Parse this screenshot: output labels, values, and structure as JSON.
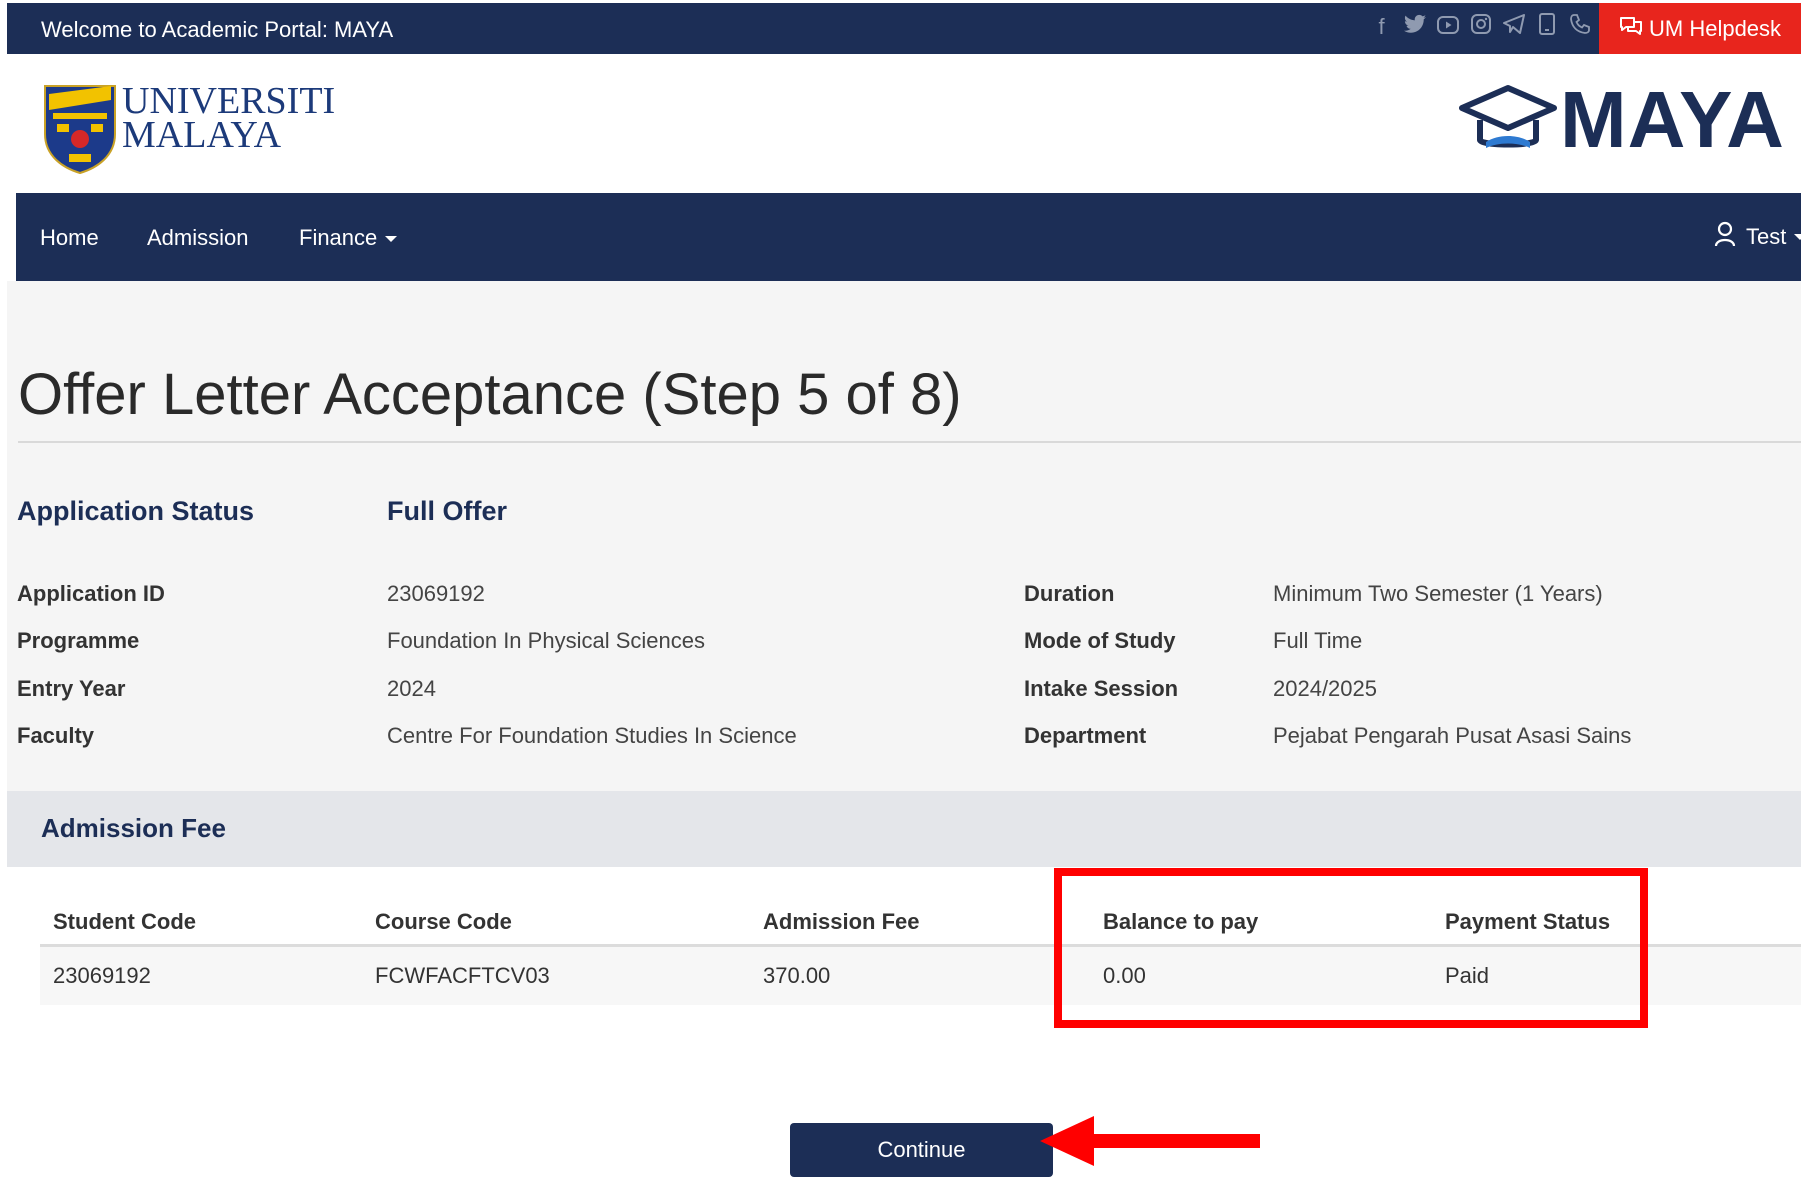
{
  "topbar": {
    "welcome": "Welcome to Academic Portal: MAYA",
    "social_icons": [
      "facebook-icon",
      "twitter-icon",
      "youtube-icon",
      "instagram-icon",
      "telegram-icon",
      "mobile-icon",
      "phone-icon"
    ],
    "helpdesk_label": "UM Helpdesk"
  },
  "header": {
    "university_line1": "UNIVERSITI",
    "university_line2": "MALAYA",
    "portal_logo_text": "MAYA"
  },
  "nav": {
    "items": [
      {
        "label": "Home"
      },
      {
        "label": "Admission"
      },
      {
        "label": "Finance"
      }
    ],
    "user_label": "Test"
  },
  "page": {
    "title": "Offer Letter Acceptance (Step 5 of 8)",
    "status_label": "Application Status",
    "status_value": "Full Offer",
    "info_left": [
      {
        "label": "Application ID",
        "value": "23069192"
      },
      {
        "label": "Programme",
        "value": "Foundation In Physical Sciences"
      },
      {
        "label": "Entry Year",
        "value": "2024"
      },
      {
        "label": "Faculty",
        "value": "Centre For Foundation Studies In Science"
      }
    ],
    "info_right": [
      {
        "label": "Duration",
        "value": "Minimum Two Semester (1 Years)"
      },
      {
        "label": "Mode of Study",
        "value": "Full Time"
      },
      {
        "label": "Intake Session",
        "value": "2024/2025"
      },
      {
        "label": "Department",
        "value": "Pejabat Pengarah Pusat Asasi Sains"
      }
    ]
  },
  "fee": {
    "title": "Admission Fee",
    "columns": [
      "Student Code",
      "Course Code",
      "Admission Fee",
      "Balance to pay",
      "Payment Status"
    ],
    "rows": [
      [
        "23069192",
        "FCWFACFTCV03",
        "370.00",
        "0.00",
        "Paid"
      ]
    ]
  },
  "actions": {
    "continue_label": "Continue"
  },
  "colors": {
    "navy": "#1c2e56",
    "helpdesk_red": "#e8251d",
    "annotation_red": "#ff0000"
  }
}
